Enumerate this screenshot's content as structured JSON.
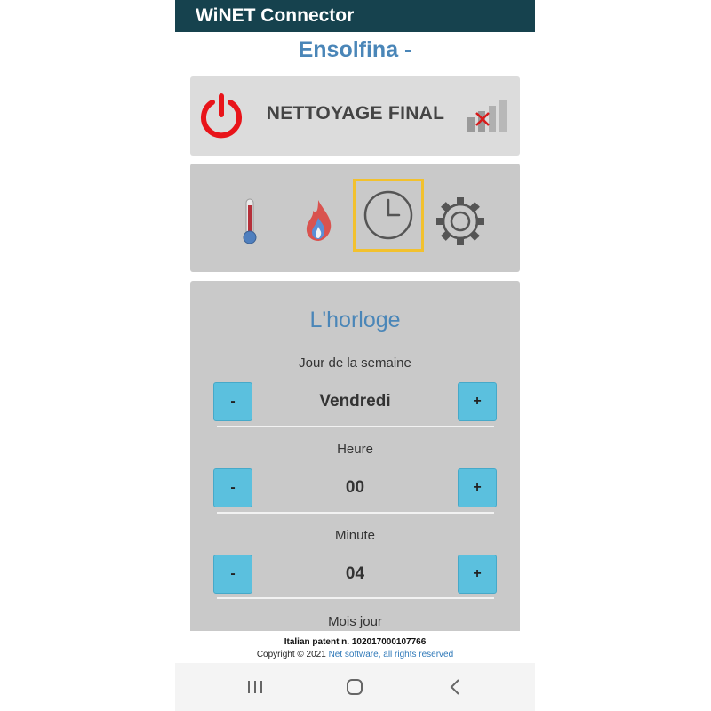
{
  "app": {
    "title": "WiNET Connector"
  },
  "device": {
    "name": "Ensolfina -"
  },
  "status": {
    "text": "NETTOYAGE FINAL",
    "power_color": "#e8141a",
    "signal_state": "disconnected"
  },
  "tabs": [
    {
      "icon": "thermometer-icon",
      "active": false
    },
    {
      "icon": "flame-icon",
      "active": false
    },
    {
      "icon": "clock-icon",
      "active": true
    },
    {
      "icon": "gear-icon",
      "active": false
    }
  ],
  "clock": {
    "title": "L'horloge",
    "fields": [
      {
        "label": "Jour de la semaine",
        "value": "Vendredi",
        "minus": "-",
        "plus": "+"
      },
      {
        "label": "Heure",
        "value": "00",
        "minus": "-",
        "plus": "+"
      },
      {
        "label": "Minute",
        "value": "04",
        "minus": "-",
        "plus": "+"
      },
      {
        "label": "Mois jour"
      }
    ]
  },
  "footer": {
    "patent": "Italian patent n. 102017000107766",
    "copyright_prefix": "Copyright © 2021 ",
    "copyright_link": "Net software, all rights reserved"
  },
  "colors": {
    "appbar": "#16424e",
    "accent": "#4a86b8",
    "button": "#5bc0de",
    "active_tab_border": "#f2c12e"
  }
}
